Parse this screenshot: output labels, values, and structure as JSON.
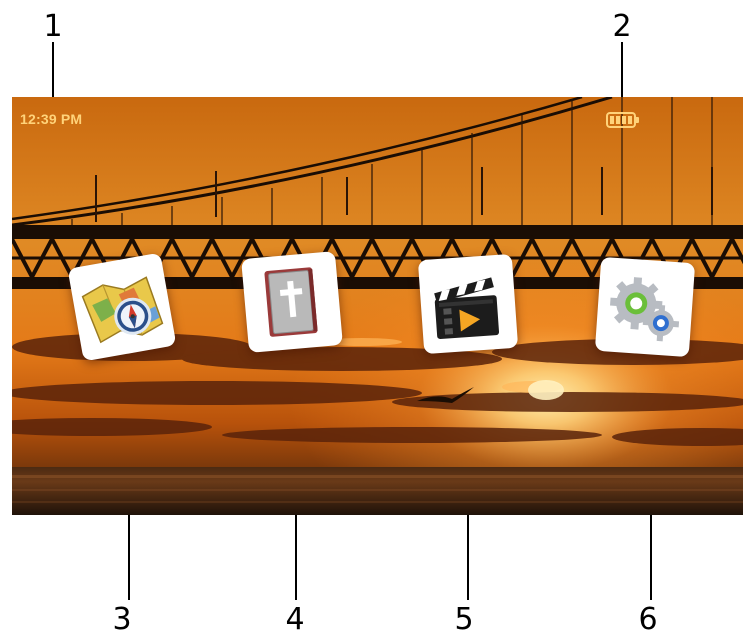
{
  "callouts": [
    "1",
    "2",
    "3",
    "4",
    "5",
    "6"
  ],
  "status_bar": {
    "time": "12:39 PM",
    "battery_icon": "battery-full-icon"
  },
  "apps": [
    {
      "icon": "map-compass-icon"
    },
    {
      "icon": "bible-book-icon"
    },
    {
      "icon": "video-clapperboard-icon"
    },
    {
      "icon": "settings-gears-icon"
    }
  ],
  "colors": {
    "clock_text": "#ffd37a",
    "sky_top": "#c9690f",
    "sun_glow": "#ffd27a",
    "bridge": "#1a0d04"
  }
}
